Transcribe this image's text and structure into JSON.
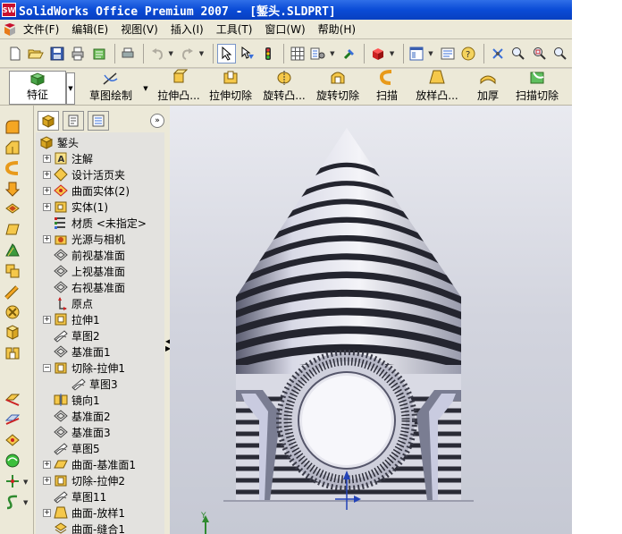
{
  "window": {
    "title": "SolidWorks Office Premium 2007 - [錾头.SLDPRT]",
    "app_logo": "SW"
  },
  "menubar": {
    "items": [
      "文件(F)",
      "编辑(E)",
      "视图(V)",
      "插入(I)",
      "工具(T)",
      "窗口(W)",
      "帮助(H)"
    ]
  },
  "commandmanager": {
    "feature_label": "特征",
    "sketch_label": "草图绘制",
    "tools": [
      "拉伸凸...",
      "拉伸切除",
      "旋转凸...",
      "旋转切除",
      "扫描",
      "放样凸...",
      "加厚",
      "扫描切除"
    ]
  },
  "feature_tree": {
    "root": "錾头",
    "items": [
      {
        "label": "注解",
        "icon": "annotation-icon",
        "expand": "+"
      },
      {
        "label": "设计活页夹",
        "icon": "design-binder-icon",
        "expand": "+"
      },
      {
        "label": "曲面实体(2)",
        "icon": "surface-bodies-icon",
        "expand": "+"
      },
      {
        "label": "实体(1)",
        "icon": "solid-bodies-icon",
        "expand": "+"
      },
      {
        "label": "材质 <未指定>",
        "icon": "material-icon",
        "expand": ""
      },
      {
        "label": "光源与相机",
        "icon": "lights-cameras-icon",
        "expand": "+"
      },
      {
        "label": "前视基准面",
        "icon": "plane-icon",
        "expand": ""
      },
      {
        "label": "上视基准面",
        "icon": "plane-icon",
        "expand": ""
      },
      {
        "label": "右视基准面",
        "icon": "plane-icon",
        "expand": ""
      },
      {
        "label": "原点",
        "icon": "origin-icon",
        "expand": ""
      },
      {
        "label": "拉伸1",
        "icon": "extrude-icon",
        "expand": "+"
      },
      {
        "label": "草图2",
        "icon": "sketch-icon",
        "expand": ""
      },
      {
        "label": "基准面1",
        "icon": "plane-icon",
        "expand": ""
      },
      {
        "label": "切除-拉伸1",
        "icon": "cut-extrude-icon",
        "expand": "−"
      },
      {
        "label": "草图3",
        "icon": "sketch-icon",
        "expand": "",
        "child": true
      },
      {
        "label": "镜向1",
        "icon": "mirror-icon",
        "expand": ""
      },
      {
        "label": "基准面2",
        "icon": "plane-icon",
        "expand": ""
      },
      {
        "label": "基准面3",
        "icon": "plane-icon",
        "expand": ""
      },
      {
        "label": "草图5",
        "icon": "sketch-icon",
        "expand": ""
      },
      {
        "label": "曲面-基准面1",
        "icon": "surface-plane-icon",
        "expand": "+"
      },
      {
        "label": "切除-拉伸2",
        "icon": "cut-extrude-icon",
        "expand": "+"
      },
      {
        "label": "草图11",
        "icon": "sketch-icon",
        "expand": ""
      },
      {
        "label": "曲面-放样1",
        "icon": "surface-loft-icon",
        "expand": "+"
      },
      {
        "label": "曲面-缝合1",
        "icon": "surface-knit-icon",
        "expand": ""
      }
    ]
  },
  "viewport": {
    "triad_label": "Y"
  },
  "colors": {
    "title_bar": "#0a4bd6",
    "tree_bg": "#e3e2df",
    "viewport_bg": "#d2d4de"
  }
}
